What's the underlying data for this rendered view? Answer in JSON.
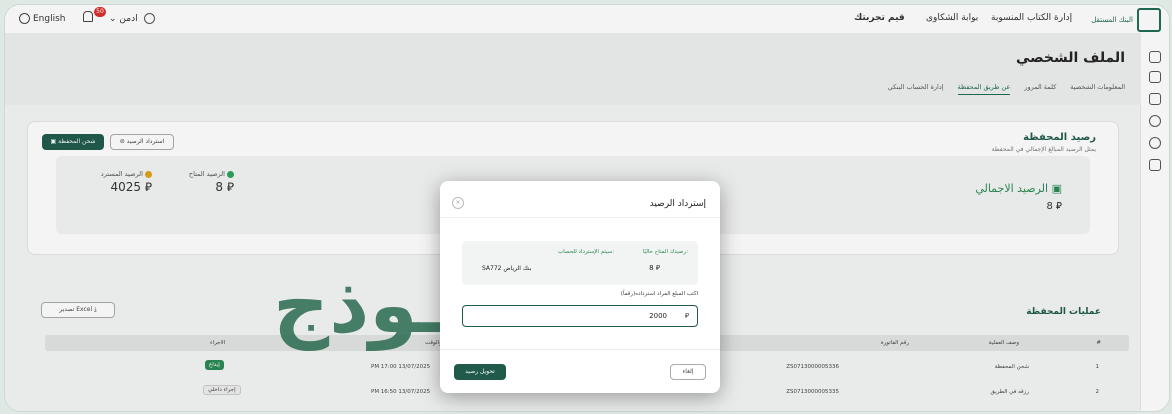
{
  "topbar": {
    "language": "English",
    "notif_count": "50",
    "user": "ادمن",
    "nav": [
      "قيم تجربتك",
      "بوابة الشكاوى",
      "إدارة الكتاب المنسوبة"
    ],
    "logo_text": "البنك المستقل"
  },
  "page": {
    "title": "الملف الشخصي",
    "tabs": [
      "المعلومات الشخصية",
      "كلمة المرور",
      "عن طريق المحفظة",
      "إدارة الحساب البنكي"
    ],
    "active_tab": "عن طريق المحفظة"
  },
  "wallet": {
    "title": "رصيد المحفظة",
    "subtitle": "يمثل الرصيد المبالغ الإجمالي في المحفظة",
    "total_label": "الرصيد الاجمالي",
    "total_value": "8",
    "available_label": "الرصيد المتاح",
    "available_value": "8",
    "reserved_label": "الرصيد المسترد",
    "reserved_value": "4025",
    "charge_button": "شحن المحفظة",
    "refund_button": "استرداد الرصيد"
  },
  "ops": {
    "title": "عمليات المحفظة",
    "export_button": "تصدير Excel",
    "columns": [
      "#",
      "وصف العملية",
      "رقم الفاتورة",
      "التاريخ والوقت",
      "الاجراء"
    ],
    "rows": [
      {
        "n": "1",
        "desc": "شحن المحفظة",
        "invoice": "ZS0713000005336",
        "date": "PM 17:00 13/07/2025",
        "action": "إيداع"
      },
      {
        "n": "2",
        "desc": "رزقه في الطريق",
        "invoice": "ZS0713000005335",
        "date": "PM 16:50 13/07/2025",
        "action": "إجراء داخلي"
      }
    ]
  },
  "modal": {
    "title": "إسترداد الرصيد",
    "available_label": "رصيدك المتاح حاليًا:",
    "available_value": "8",
    "refund_to_label": "سيتم الإسترداد للحساب:",
    "refund_to_value": "SA772 بنك الرياض",
    "input_label": "اكتب المبلغ المراد استرداده(رقماً)",
    "input_value": "2000",
    "confirm_button": "تحويل رصيد",
    "cancel_button": "إلغاء"
  },
  "watermark": "نمــــوذج",
  "colors": {
    "primary": "#1f5a4a",
    "available_dot": "#2aa35a",
    "reserved_dot": "#e0a21a",
    "badge": "#d9302c"
  }
}
